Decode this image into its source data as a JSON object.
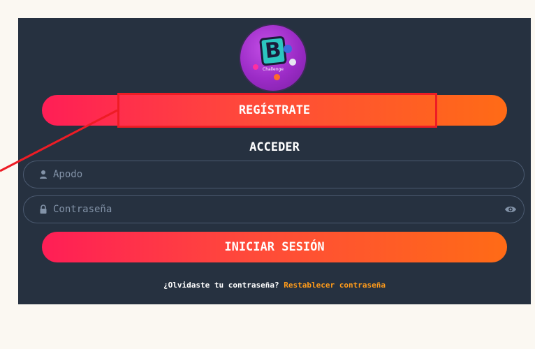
{
  "logo": {
    "letter": "B",
    "caption": "Challenge"
  },
  "buttons": {
    "register_label": "REGÍSTRATE",
    "login_label": "INICIAR SESIÓN"
  },
  "form": {
    "title": "ACCEDER",
    "username_placeholder": "Apodo",
    "password_placeholder": "Contraseña"
  },
  "forgot": {
    "question": "¿Olvidaste tu contraseña?",
    "link": "Restablecer contraseña"
  },
  "colors": {
    "page_background": "#fbf8f2",
    "panel_background": "#263140",
    "button_gradient_start": "#ff1e56",
    "button_gradient_end": "#ff6b16",
    "link": "#ff9b1a",
    "annotation": "#ee1c25"
  },
  "icons": {
    "username": "user-icon",
    "password": "lock-icon",
    "show_password": "eye-icon"
  }
}
